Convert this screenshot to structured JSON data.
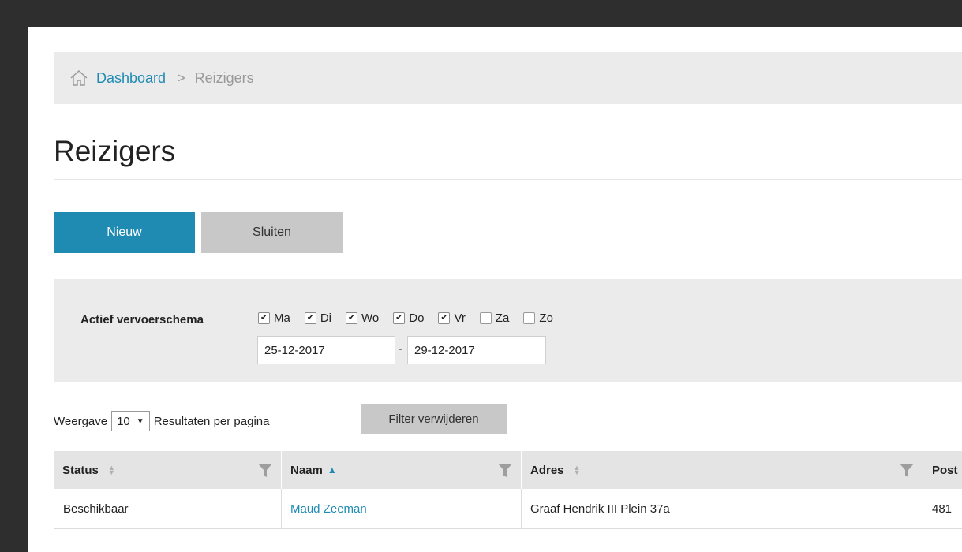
{
  "breadcrumb": {
    "home_icon": "home-icon",
    "link": "Dashboard",
    "separator": ">",
    "current": "Reizigers"
  },
  "page_title": "Reizigers",
  "buttons": {
    "new": "Nieuw",
    "close": "Sluiten",
    "remove_filter": "Filter verwijderen"
  },
  "filter": {
    "label": "Actief vervoerschema",
    "days": [
      {
        "label": "Ma",
        "checked": true
      },
      {
        "label": "Di",
        "checked": true
      },
      {
        "label": "Wo",
        "checked": true
      },
      {
        "label": "Do",
        "checked": true
      },
      {
        "label": "Vr",
        "checked": true
      },
      {
        "label": "Za",
        "checked": false
      },
      {
        "label": "Zo",
        "checked": false
      }
    ],
    "date_from": "25-12-2017",
    "date_separator": "-",
    "date_to": "29-12-2017"
  },
  "page_size": {
    "prefix": "Weergave",
    "value": "10",
    "suffix": "Resultaten per pagina"
  },
  "table": {
    "columns": [
      "Status",
      "Naam",
      "Adres",
      "Post"
    ],
    "rows": [
      [
        "Beschikbaar",
        "Maud Zeeman",
        "Graaf Hendrik III Plein 37a",
        "481"
      ]
    ]
  },
  "colors": {
    "accent": "#1f8bb3",
    "panel": "#ebebeb",
    "frame": "#2e2e2e"
  }
}
